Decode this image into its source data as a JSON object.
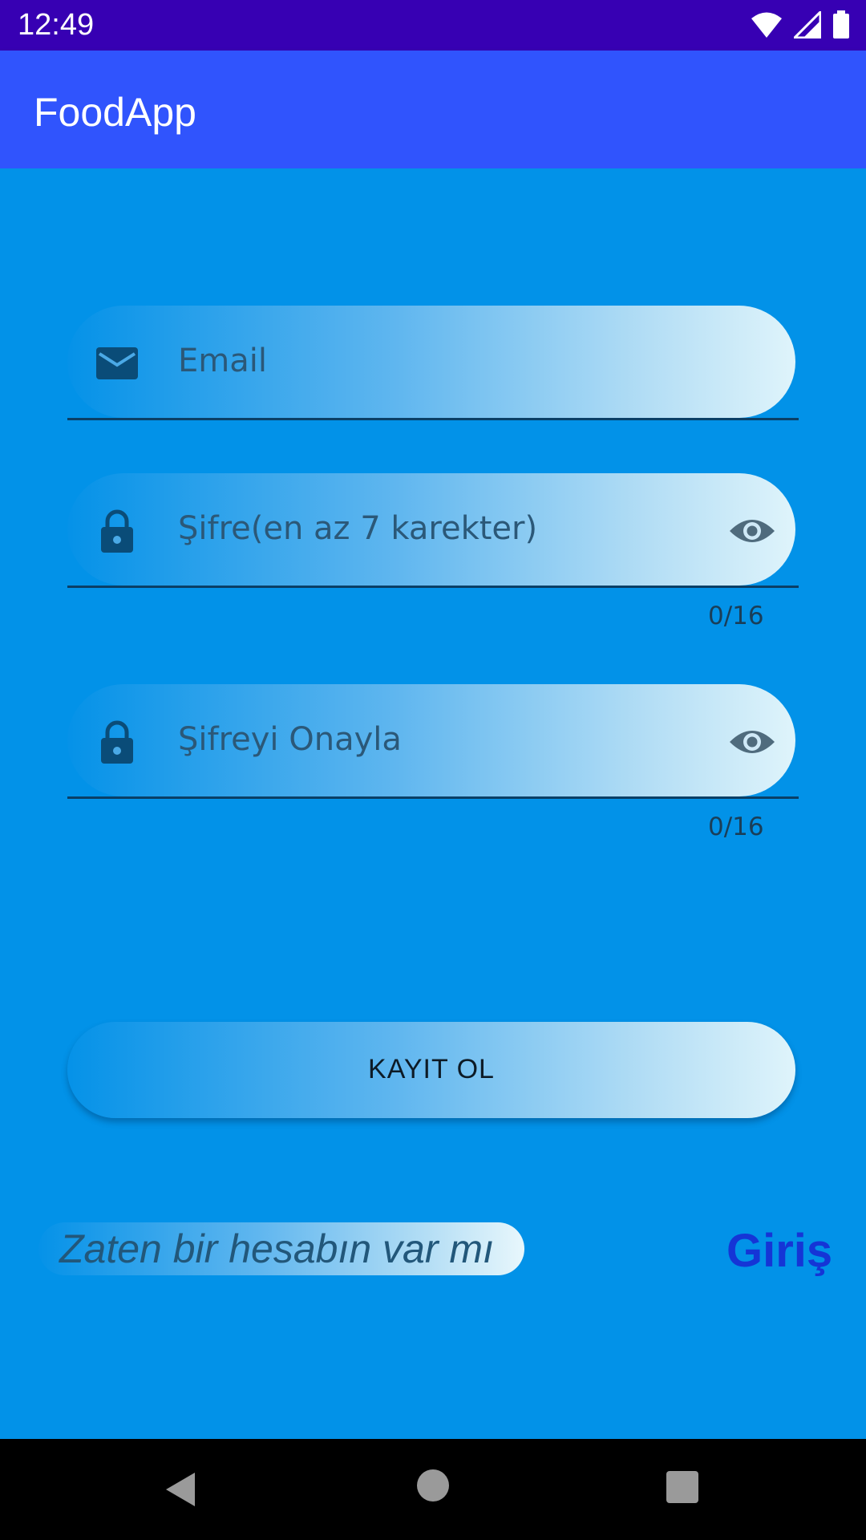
{
  "status_bar": {
    "time": "12:49",
    "icons": [
      "wifi-icon",
      "signal-icon",
      "battery-icon"
    ]
  },
  "app_bar": {
    "title": "FoodApp"
  },
  "form": {
    "email": {
      "placeholder": "Email",
      "icon": "email-icon"
    },
    "password": {
      "placeholder": "Şifre(en az 7 karekter)",
      "icon": "lock-icon",
      "toggle_icon": "eye-icon",
      "counter": "0/16"
    },
    "confirm_password": {
      "placeholder": "Şifreyi Onayla",
      "icon": "lock-icon",
      "toggle_icon": "eye-icon",
      "counter": "0/16"
    },
    "register_button": "KAYIT OL"
  },
  "footer": {
    "hint": "Zaten bir hesabın var mı",
    "login_link": "Giriş"
  },
  "nav_bar": {
    "icons": [
      "back-icon",
      "home-icon",
      "recents-icon"
    ]
  },
  "colors": {
    "status_bar": "#3700b3",
    "app_bar": "#3054fd",
    "background": "#0292e8",
    "login_link": "#1535d6"
  }
}
